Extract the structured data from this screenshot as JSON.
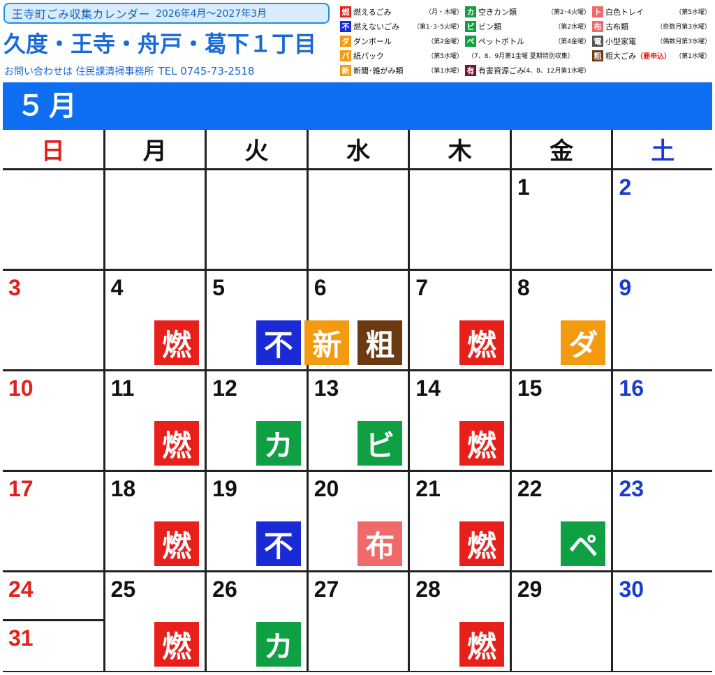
{
  "header": {
    "title": "王寺町ごみ収集カレンダー",
    "period": "2026年4月～2027年3月",
    "district": "久度・王寺・舟戸・葛下１丁目",
    "contact": "お問い合わせは 住民課清掃事務所",
    "tel": "TEL 0745-73-2518"
  },
  "legend": [
    {
      "code": "燃",
      "label": "燃えるごみ",
      "note": "（月・木曜）",
      "color": "#e8201b"
    },
    {
      "code": "カ",
      "label": "空きカン類",
      "note": "（第2･4火曜）",
      "color": "#10a044"
    },
    {
      "code": "ト",
      "label": "白色トレイ",
      "note": "（第5水曜）",
      "color": "#f06a6a"
    },
    {
      "code": "不",
      "label": "燃えないごみ",
      "note": "（第1･3･5火曜）",
      "color": "#1a2bd6"
    },
    {
      "code": "ビ",
      "label": "ビン類",
      "note": "（第2水曜）",
      "color": "#10a044"
    },
    {
      "code": "布",
      "label": "古布類",
      "note": "（奇数月第3水曜）",
      "color": "#f06a6a"
    },
    {
      "code": "ダ",
      "label": "ダンボール",
      "note": "（第2金曜）",
      "color": "#f39a10"
    },
    {
      "code": "ペ",
      "label": "ペットボトル",
      "note": "（第4金曜）",
      "color": "#10a044"
    },
    {
      "code": "電",
      "label": "小型家電",
      "note": "（偶数月第3水曜）",
      "color": "#555555"
    },
    {
      "code": "パ",
      "label": "紙パック",
      "note": "（第5水曜）",
      "color": "#f39a10"
    },
    {
      "code": "",
      "label": "",
      "note": "（7、8、9月第1金曜 夏期特別収集）",
      "color": ""
    },
    {
      "code": "粗",
      "label": "粗大ごみ",
      "required": "（要申込）",
      "note": "（第1水曜）",
      "color": "#6b3a12"
    },
    {
      "code": "新",
      "label": "新聞･雑がみ類",
      "note": "（第1水曜）",
      "color": "#f39a10"
    },
    {
      "code": "有",
      "label": "有害資源ごみ",
      "note": "（4、8、12月第1水曜）",
      "color": "#7a1030"
    }
  ],
  "calendar": {
    "month": "５月",
    "weekdays": [
      "日",
      "月",
      "火",
      "水",
      "木",
      "金",
      "土"
    ],
    "weeks": [
      [
        {
          "day": ""
        },
        {
          "day": ""
        },
        {
          "day": ""
        },
        {
          "day": ""
        },
        {
          "day": ""
        },
        {
          "day": "1"
        },
        {
          "day": "2"
        }
      ],
      [
        {
          "day": "3"
        },
        {
          "day": "4",
          "badges": [
            {
              "t": "燃",
              "c": "#e8201b"
            }
          ]
        },
        {
          "day": "5",
          "badges": [
            {
              "t": "不",
              "c": "#1a2bd6"
            }
          ]
        },
        {
          "day": "6",
          "badges": [
            {
              "t": "新",
              "c": "#f39a10"
            },
            {
              "t": "粗",
              "c": "#6b3a12"
            }
          ]
        },
        {
          "day": "7",
          "badges": [
            {
              "t": "燃",
              "c": "#e8201b"
            }
          ]
        },
        {
          "day": "8",
          "badges": [
            {
              "t": "ダ",
              "c": "#f39a10"
            }
          ]
        },
        {
          "day": "9"
        }
      ],
      [
        {
          "day": "10"
        },
        {
          "day": "11",
          "badges": [
            {
              "t": "燃",
              "c": "#e8201b"
            }
          ]
        },
        {
          "day": "12",
          "badges": [
            {
              "t": "カ",
              "c": "#10a044"
            }
          ]
        },
        {
          "day": "13",
          "badges": [
            {
              "t": "ビ",
              "c": "#10a044"
            }
          ]
        },
        {
          "day": "14",
          "badges": [
            {
              "t": "燃",
              "c": "#e8201b"
            }
          ]
        },
        {
          "day": "15"
        },
        {
          "day": "16"
        }
      ],
      [
        {
          "day": "17"
        },
        {
          "day": "18",
          "badges": [
            {
              "t": "燃",
              "c": "#e8201b"
            }
          ]
        },
        {
          "day": "19",
          "badges": [
            {
              "t": "不",
              "c": "#1a2bd6"
            }
          ]
        },
        {
          "day": "20",
          "badges": [
            {
              "t": "布",
              "c": "#f06a6a"
            }
          ]
        },
        {
          "day": "21",
          "badges": [
            {
              "t": "燃",
              "c": "#e8201b"
            }
          ]
        },
        {
          "day": "22",
          "badges": [
            {
              "t": "ペ",
              "c": "#10a044"
            }
          ]
        },
        {
          "day": "23"
        }
      ],
      [
        {
          "day": "24",
          "day2": "31"
        },
        {
          "day": "25",
          "badges": [
            {
              "t": "燃",
              "c": "#e8201b"
            }
          ]
        },
        {
          "day": "26",
          "badges": [
            {
              "t": "カ",
              "c": "#10a044"
            }
          ]
        },
        {
          "day": "27"
        },
        {
          "day": "28",
          "badges": [
            {
              "t": "燃",
              "c": "#e8201b"
            }
          ]
        },
        {
          "day": "29"
        },
        {
          "day": "30"
        }
      ]
    ]
  }
}
